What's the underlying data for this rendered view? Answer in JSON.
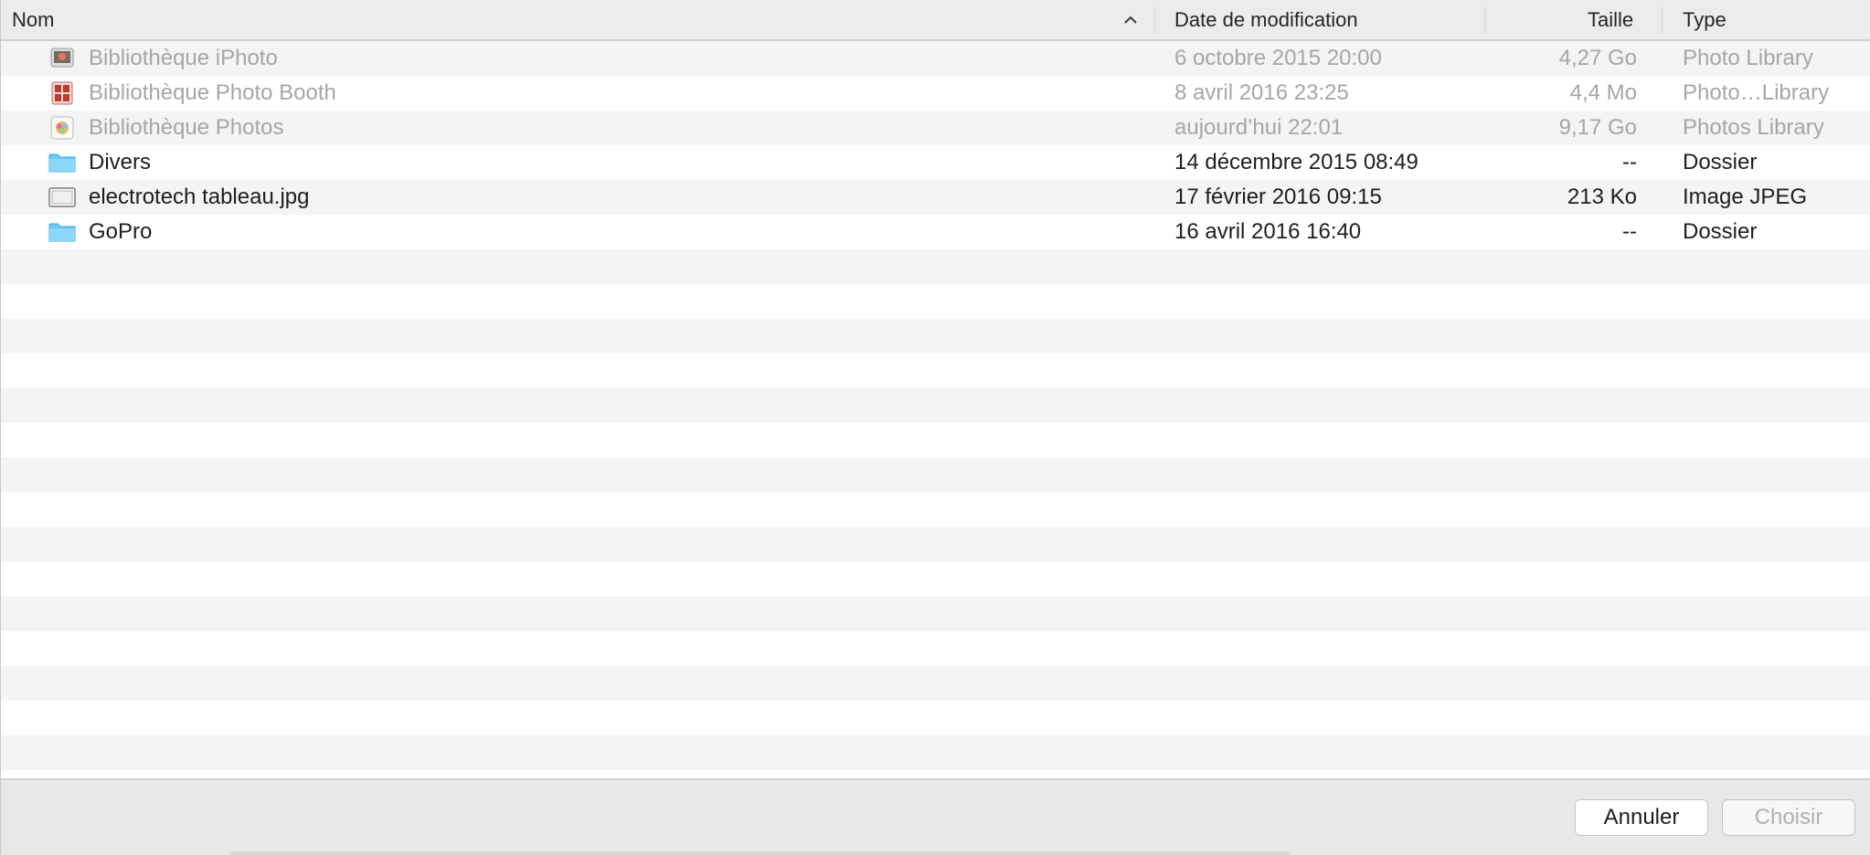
{
  "header": {
    "name": "Nom",
    "date": "Date de modification",
    "size": "Taille",
    "type": "Type"
  },
  "files": [
    {
      "name": "Bibliothèque iPhoto",
      "date": "6 octobre 2015 20:00",
      "size": "4,27 Go",
      "type": "Photo Library",
      "icon": "iphoto-library-icon",
      "dim": true
    },
    {
      "name": "Bibliothèque Photo Booth",
      "date": "8 avril 2016 23:25",
      "size": "4,4 Mo",
      "type": "Photo…Library",
      "icon": "photo-booth-library-icon",
      "dim": true
    },
    {
      "name": "Bibliothèque Photos",
      "date": "aujourd’hui 22:01",
      "size": "9,17 Go",
      "type": "Photos Library",
      "icon": "photos-library-icon",
      "dim": true
    },
    {
      "name": "Divers",
      "date": "14 décembre 2015 08:49",
      "size": "--",
      "type": "Dossier",
      "icon": "folder-icon",
      "dim": false
    },
    {
      "name": "electrotech tableau.jpg",
      "date": "17 février 2016 09:15",
      "size": "213 Ko",
      "type": "Image JPEG",
      "icon": "jpeg-file-icon",
      "dim": false
    },
    {
      "name": "GoPro",
      "date": "16 avril 2016 16:40",
      "size": "--",
      "type": "Dossier",
      "icon": "folder-icon",
      "dim": false
    }
  ],
  "buttons": {
    "cancel": "Annuler",
    "choose": "Choisir"
  },
  "colors": {
    "folder": "#6ccaf5",
    "stripe": "#f4f4f4"
  }
}
